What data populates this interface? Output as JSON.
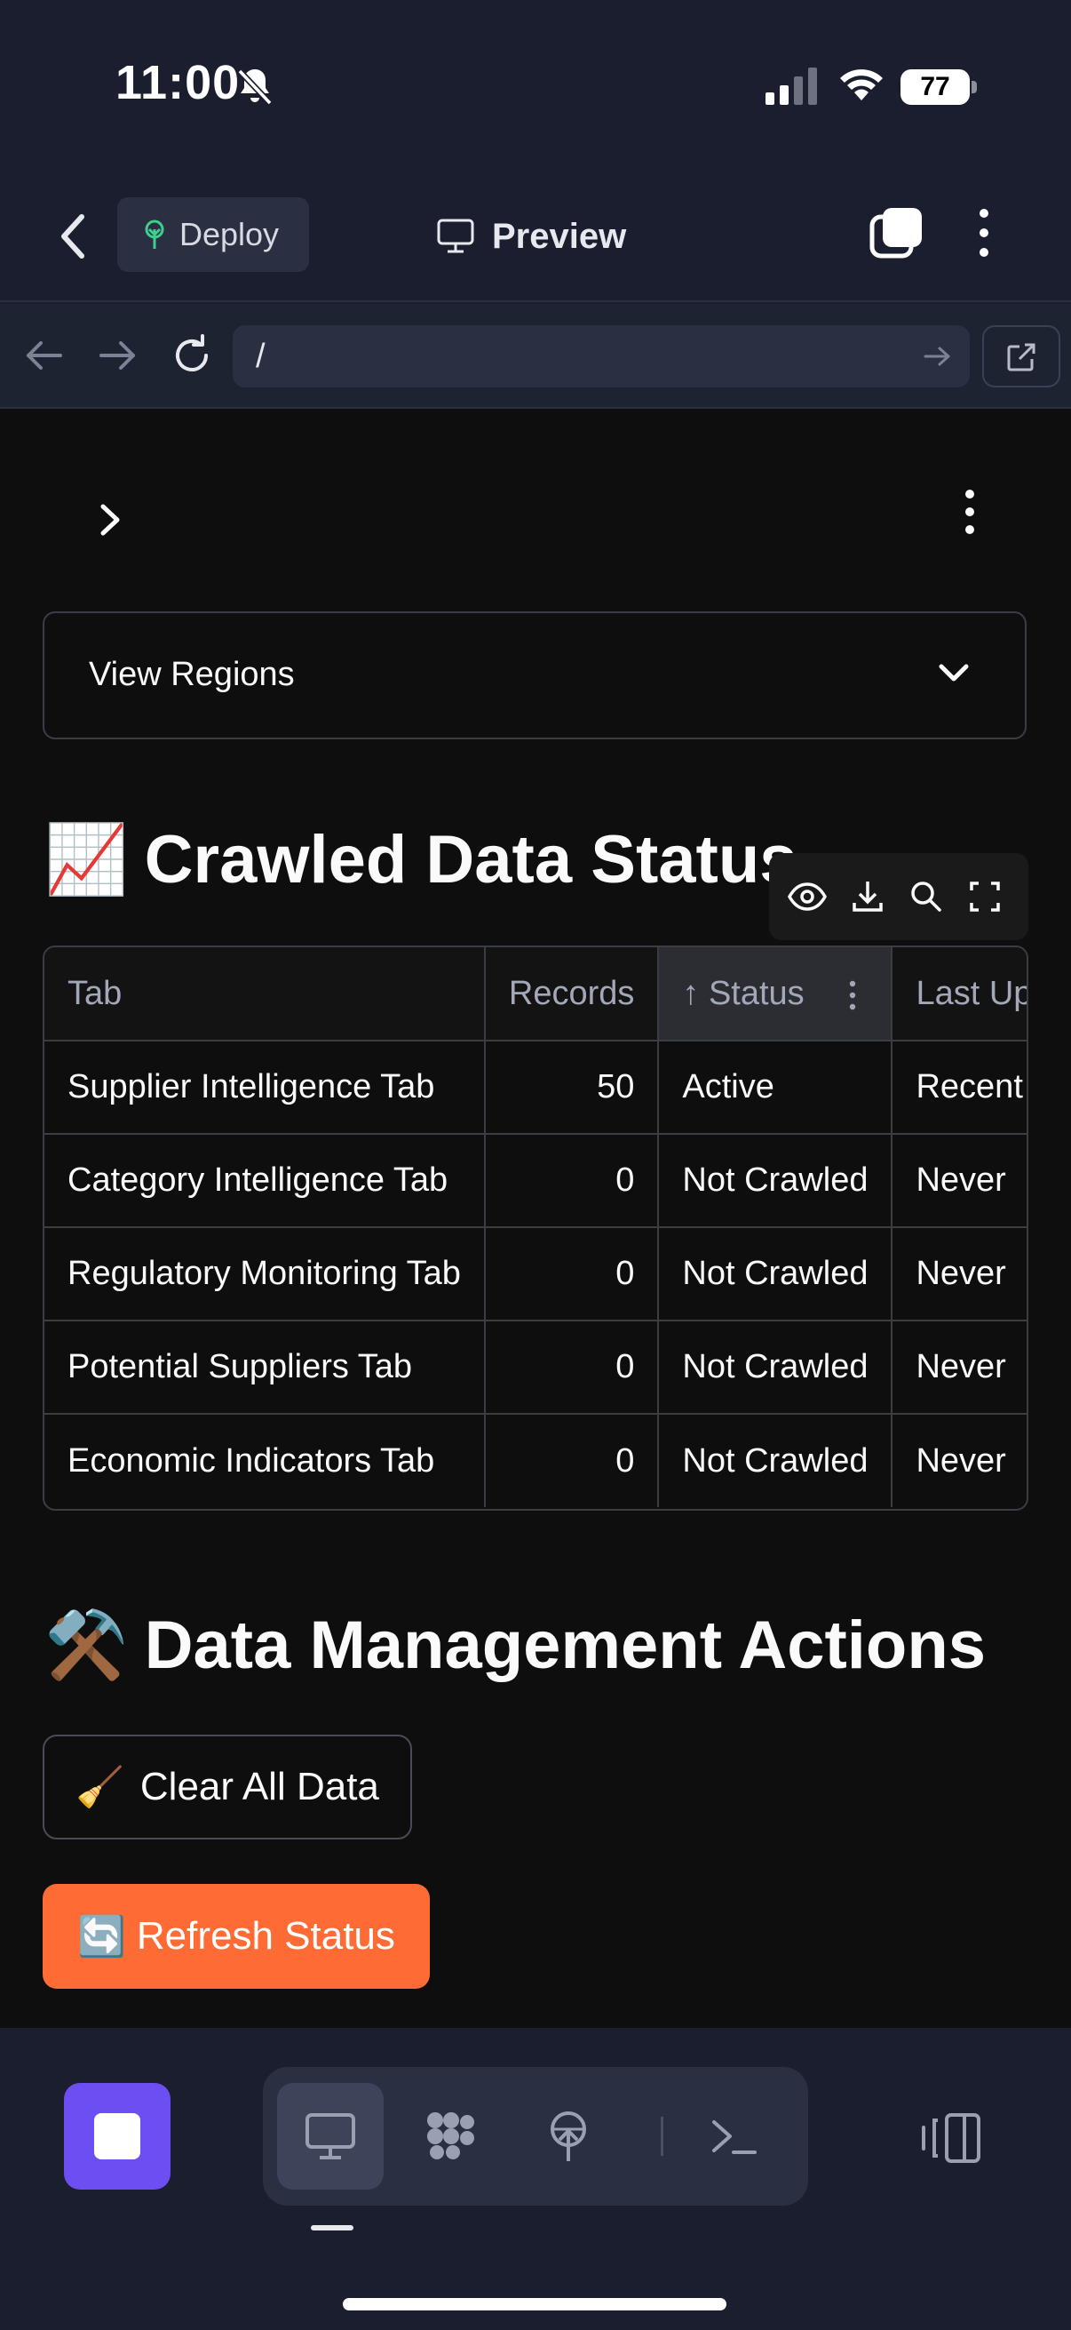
{
  "status_bar": {
    "time": "11:00",
    "battery": "77"
  },
  "app_bar": {
    "deploy_label": "Deploy",
    "preview_label": "Preview"
  },
  "url_bar": {
    "path": "/"
  },
  "expander": {
    "label": "View Regions"
  },
  "crawl_section": {
    "emoji": "📈",
    "title": "Crawled Data Status",
    "table": {
      "headers": [
        "Tab",
        "Records",
        "Status",
        "Last Up"
      ],
      "rows": [
        [
          "Supplier Intelligence Tab",
          "50",
          "Active",
          "Recent"
        ],
        [
          "Category Intelligence Tab",
          "0",
          "Not Crawled",
          "Never"
        ],
        [
          "Regulatory Monitoring Tab",
          "0",
          "Not Crawled",
          "Never"
        ],
        [
          "Potential Suppliers Tab",
          "0",
          "Not Crawled",
          "Never"
        ],
        [
          "Economic Indicators Tab",
          "0",
          "Not Crawled",
          "Never"
        ]
      ]
    }
  },
  "actions_section": {
    "emoji": "⚒️",
    "title": "Data Management Actions",
    "clear_emoji": "🧹",
    "clear_label": "Clear All Data",
    "refresh_emoji": "🔄",
    "refresh_label": "Refresh Status"
  },
  "colors": {
    "accent": "#ff6b35",
    "stop": "#6c4ef2",
    "chrome": "#1a1e2e"
  }
}
